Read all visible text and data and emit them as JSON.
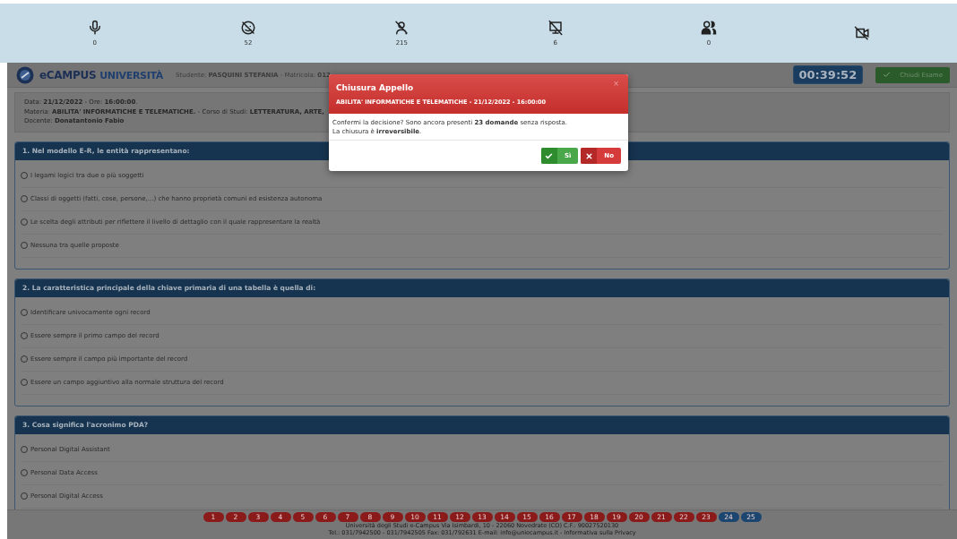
{
  "monitor_bar": [
    {
      "kind": "mic",
      "count": "0"
    },
    {
      "kind": "face",
      "count": "52"
    },
    {
      "kind": "person",
      "count": "215"
    },
    {
      "kind": "screen",
      "count": "6"
    },
    {
      "kind": "people",
      "count": "0"
    },
    {
      "kind": "video"
    }
  ],
  "header": {
    "logo": {
      "prefix": "e",
      "brand": "CAMPUS",
      "suffix": "UNIVERSITÀ"
    },
    "student": "Studente: **PASQUINI STEFANIA** - Matricola: **012**",
    "timer": "00:39:52",
    "close_button": "Chiudi Esame"
  },
  "exam_info": [
    "Data: **21/12/2022** - Ore: **16:00:00**.",
    "Materia: **ABILITA' INFORMATICHE E TELEMATICHE.** - Corso di Studi: **LETTERATURA, ARTE,**",
    "Docente: **Donatantonio Fabio**"
  ],
  "questions": [
    {
      "title": "1. Nel modello E-R, le entità rappresentano:",
      "options": [
        {
          "label": "I legami logici tra due o più soggetti",
          "selected": false
        },
        {
          "label": "Classi di oggetti (fatti, cose, persone,...) che hanno proprietà comuni ed esistenza autonoma",
          "selected": false
        },
        {
          "label": "Le scelta degli attributi per riflettere il livello di dettaglio con il quale rappresentare la realtà",
          "selected": false
        },
        {
          "label": "Nessuna tra quelle proposte",
          "selected": false
        }
      ]
    },
    {
      "title": "2. La caratteristica principale della chiave primaria di una tabella è quella di:",
      "options": [
        {
          "label": "Identificare univocamente ogni record",
          "selected": false
        },
        {
          "label": "Essere sempre il primo campo del record",
          "selected": false
        },
        {
          "label": "Essere sempre il campo più importante del record",
          "selected": false
        },
        {
          "label": "Essere un campo aggiuntivo alla normale struttura del record",
          "selected": false
        }
      ]
    },
    {
      "title": "3. Cosa significa l'acronimo PDA?",
      "options": [
        {
          "label": "Personal Digital Assistant",
          "selected": false
        },
        {
          "label": "Personal Data Access",
          "selected": false
        },
        {
          "label": "Personal Digital Access",
          "selected": false
        }
      ]
    }
  ],
  "pagination": [
    {
      "label": "1",
      "answered": false
    },
    {
      "label": "2",
      "answered": false
    },
    {
      "label": "3",
      "answered": false
    },
    {
      "label": "4",
      "answered": false
    },
    {
      "label": "5",
      "answered": false
    },
    {
      "label": "6",
      "answered": false
    },
    {
      "label": "7",
      "answered": false
    },
    {
      "label": "8",
      "answered": false
    },
    {
      "label": "9",
      "answered": false
    },
    {
      "label": "10",
      "answered": false
    },
    {
      "label": "11",
      "answered": false
    },
    {
      "label": "12",
      "answered": false
    },
    {
      "label": "13",
      "answered": false
    },
    {
      "label": "14",
      "answered": false
    },
    {
      "label": "15",
      "answered": false
    },
    {
      "label": "16",
      "answered": false
    },
    {
      "label": "17",
      "answered": false
    },
    {
      "label": "18",
      "answered": false
    },
    {
      "label": "19",
      "answered": false
    },
    {
      "label": "20",
      "answered": false
    },
    {
      "label": "21",
      "answered": false
    },
    {
      "label": "22",
      "answered": false
    },
    {
      "label": "23",
      "answered": false
    },
    {
      "label": "24",
      "answered": true
    },
    {
      "label": "25",
      "answered": true
    }
  ],
  "footer": [
    "Università degli Studi e-Campus Via Isimbardi, 10 - 22060 Novedrate (CO) C.F.: 90027520130",
    "Tel.: 031/7942500 - 031/7942505 Fax: 031/792631 E-mail: info@uniecampus.it - Informativa sulla Privacy"
  ],
  "dialog": {
    "title": "Chiusura Appello",
    "subtitle": "ABILITA' INFORMATICHE E TELEMATICHE - 21/12/2022 - 16:00:00",
    "close": "×",
    "message": [
      "Confermi la decisione? Sono ancora presenti **23 domande** senza risposta.",
      "La chiusura è **irreversibile**."
    ],
    "buttons": [
      {
        "kind": "yes",
        "label": "Sì"
      },
      {
        "kind": "no",
        "label": "No"
      }
    ]
  }
}
